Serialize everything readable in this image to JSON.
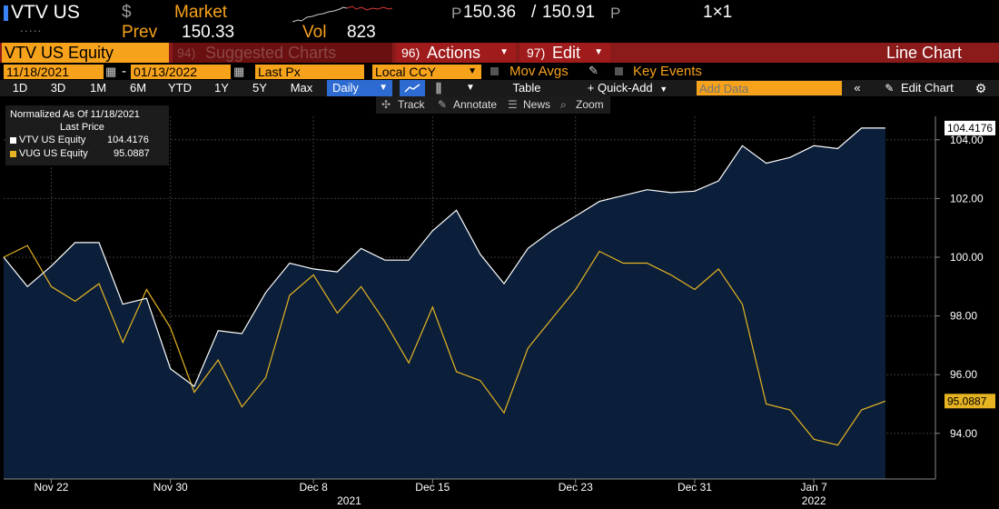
{
  "quote": {
    "ticker": "VTV US",
    "currency_symbol": "$",
    "market_label": "Market",
    "prev_label": "Prev",
    "prev_value": "150.33",
    "vol_label": "Vol",
    "vol_value": "823",
    "bid_prefix": "P",
    "bid": "150.36",
    "separator": "/",
    "ask": "150.91",
    "ask_suffix": "P",
    "size": "1×1",
    "dots": "....."
  },
  "redbar": {
    "security": "VTV US Equity",
    "suggested_num": "94)",
    "suggested": "Suggested Charts",
    "actions_num": "96)",
    "actions": "Actions",
    "edit_num": "97)",
    "edit": "Edit",
    "title": "Line Chart"
  },
  "controls": {
    "start_date": "11/18/2021",
    "dash": "-",
    "end_date": "01/13/2022",
    "field": "Last Px",
    "currency": "Local CCY",
    "mov_avgs": "Mov Avgs",
    "key_events": "Key Events"
  },
  "periods": [
    "1D",
    "3D",
    "1M",
    "6M",
    "YTD",
    "1Y",
    "5Y",
    "Max"
  ],
  "frequency": "Daily",
  "toolbar": {
    "table": "Table",
    "quick_add": "+ Quick-Add",
    "add_data_placeholder": "Add Data",
    "edit_chart": "Edit Chart"
  },
  "tools": [
    "Track",
    "Annotate",
    "News",
    "Zoom"
  ],
  "legend": {
    "line1": "Normalized As Of 11/18/2021",
    "line2": "Last Price",
    "series1": "VTV US Equity",
    "series1_value": "104.4176",
    "series2": "VUG US Equity",
    "series2_value": "95.0887"
  },
  "colors": {
    "vtv": "#ffffff",
    "vug": "#e6b422",
    "area": "#0b1f3a",
    "grid": "#3a3a3a",
    "orange": "#f7a21b",
    "red": "#8b1a1a"
  },
  "chart_data": {
    "type": "line",
    "title": "",
    "xlabel": "",
    "ylabel": "",
    "ylim": [
      92.6,
      105.0
    ],
    "yticks": [
      "94.00",
      "96.00",
      "98.00",
      "100.00",
      "102.00",
      "104.00"
    ],
    "xticks": [
      {
        "label": "Nov 22",
        "index": 2
      },
      {
        "label": "Nov 30",
        "index": 7
      },
      {
        "label": "Dec 8",
        "index": 13
      },
      {
        "label": "Dec 15",
        "index": 18
      },
      {
        "label": "Dec 23",
        "index": 24
      },
      {
        "label": "Dec 31",
        "index": 29
      },
      {
        "label": "Jan 7",
        "index": 34
      }
    ],
    "year_labels": [
      {
        "label": "2021",
        "index": 14.5
      },
      {
        "label": "2022",
        "index": 34
      }
    ],
    "grid": true,
    "series": [
      {
        "name": "VTV US Equity",
        "last_value": "104.4176",
        "values": [
          100.0,
          99.0,
          99.7,
          100.5,
          100.5,
          98.4,
          98.6,
          96.2,
          95.6,
          97.5,
          97.4,
          98.8,
          99.8,
          99.6,
          99.5,
          100.3,
          99.9,
          99.9,
          100.9,
          101.6,
          100.1,
          99.1,
          100.3,
          100.9,
          101.4,
          101.9,
          102.1,
          102.3,
          102.2,
          102.25,
          102.6,
          103.8,
          103.2,
          103.4,
          103.8,
          103.7,
          104.4,
          104.4
        ]
      },
      {
        "name": "VUG US Equity",
        "last_value": "95.0887",
        "values": [
          100.0,
          100.4,
          99.0,
          98.5,
          99.1,
          97.1,
          98.9,
          97.6,
          95.4,
          96.5,
          94.9,
          95.9,
          98.7,
          99.4,
          98.1,
          99.0,
          97.8,
          96.4,
          98.3,
          96.1,
          95.8,
          94.7,
          96.9,
          97.9,
          98.9,
          100.2,
          99.8,
          99.8,
          99.4,
          98.9,
          99.6,
          98.4,
          95.0,
          94.8,
          93.8,
          93.6,
          94.8,
          95.1
        ]
      }
    ]
  }
}
